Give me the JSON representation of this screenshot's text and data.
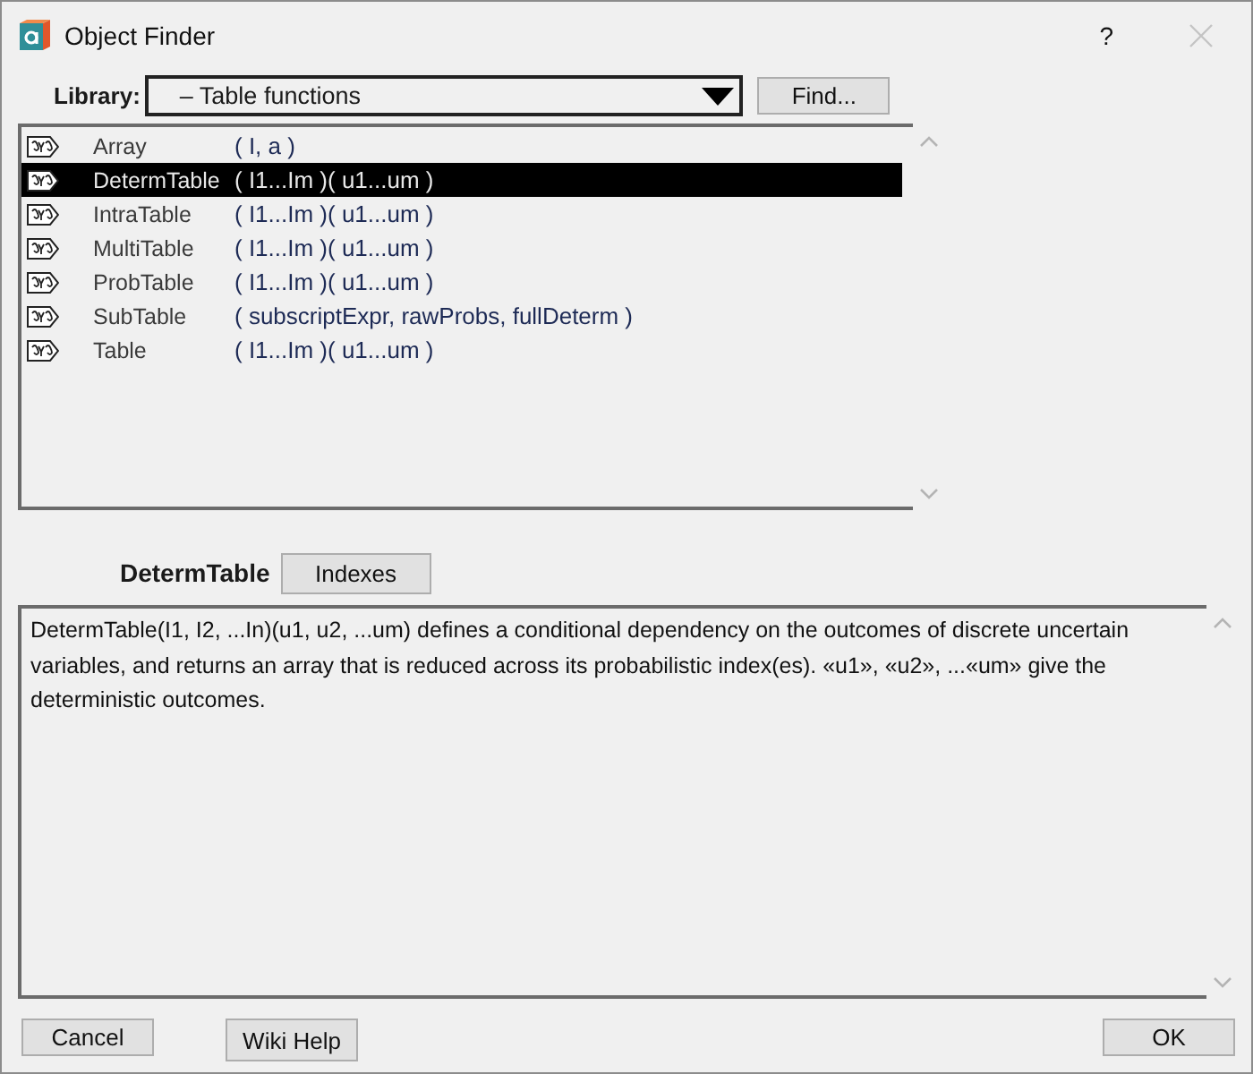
{
  "window": {
    "title": "Object Finder",
    "help_button": "?"
  },
  "library": {
    "label": "Library:",
    "value": "– Table functions",
    "find_button": "Find..."
  },
  "functions": [
    {
      "name": "Array",
      "params": "( I, a )",
      "selected": false
    },
    {
      "name": "DetermTable",
      "params": "( I1...Im )( u1...um )",
      "selected": true
    },
    {
      "name": "IntraTable",
      "params": "( I1...Im )( u1...um )",
      "selected": false
    },
    {
      "name": "MultiTable",
      "params": "( I1...Im )( u1...um )",
      "selected": false
    },
    {
      "name": "ProbTable",
      "params": "( I1...Im )( u1...um )",
      "selected": false
    },
    {
      "name": "SubTable",
      "params": "( subscriptExpr, rawProbs, fullDeterm )",
      "selected": false
    },
    {
      "name": "Table",
      "params": "( I1...Im )( u1...um )",
      "selected": false
    }
  ],
  "detail": {
    "name": "DetermTable",
    "indexes_button": "Indexes",
    "description": "DetermTable(I1, I2, ...In)(u1, u2, ...um) defines a conditional dependency on the outcomes of discrete uncertain variables, and returns an array that is reduced across its probabilistic index(es). «u1», «u2», ...«um» give the deterministic outcomes."
  },
  "buttons": [
    "Cancel",
    "Wiki Help",
    "OK"
  ]
}
